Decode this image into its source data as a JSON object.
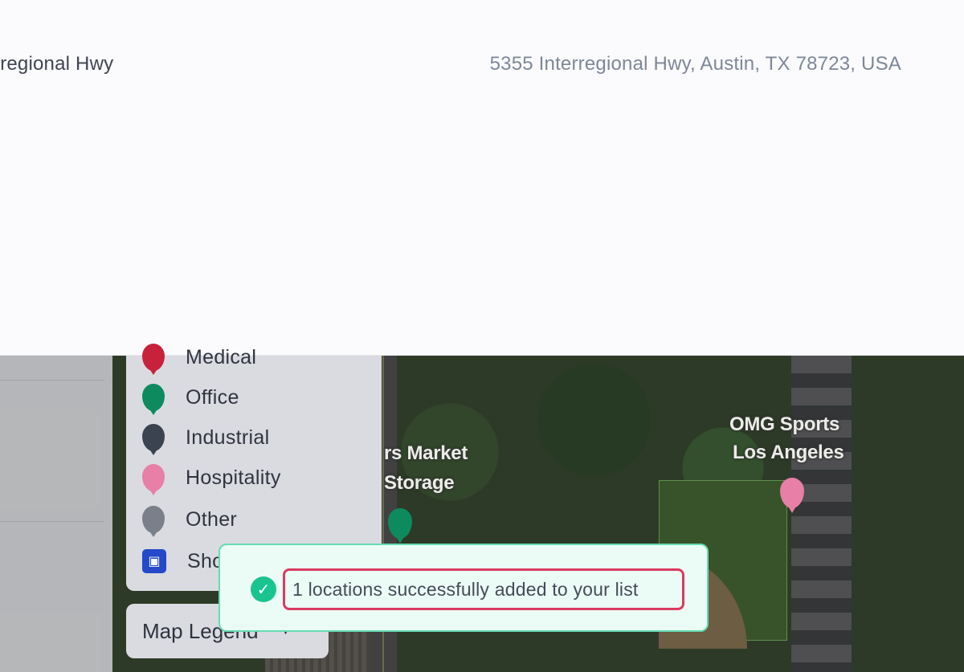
{
  "header": {
    "left_address": "rregional Hwy",
    "right_address": "5355 Interregional Hwy, Austin, TX 78723, USA"
  },
  "map": {
    "labels": [
      {
        "text": "rs Market"
      },
      {
        "text": "Storage"
      },
      {
        "text": "OMG Sports"
      },
      {
        "text": "Los Angeles"
      }
    ]
  },
  "legend": {
    "items": [
      {
        "label": "Medical",
        "icon": "pin-icon",
        "color": "#c8213c"
      },
      {
        "label": "Office",
        "icon": "pin-icon",
        "color": "#0e8a5f"
      },
      {
        "label": "Industrial",
        "icon": "pin-icon",
        "color": "#3b4250"
      },
      {
        "label": "Hospitality",
        "icon": "pin-icon",
        "color": "#e77fa6"
      },
      {
        "label": "Other",
        "icon": "pin-icon",
        "color": "#7a8089"
      },
      {
        "label": "Sho",
        "icon": "storefront-icon",
        "color": "#2549c8"
      }
    ],
    "toggle_label": "Map Legend",
    "toggle_icon": "chevron-down-icon"
  },
  "toast": {
    "message": "1 locations successfully added to your list",
    "icon": "check-circle-icon",
    "colors": {
      "background": "#ebfbf6",
      "border": "#66dbb2",
      "check": "#19c48f",
      "highlight": "#dc3a5f"
    }
  }
}
